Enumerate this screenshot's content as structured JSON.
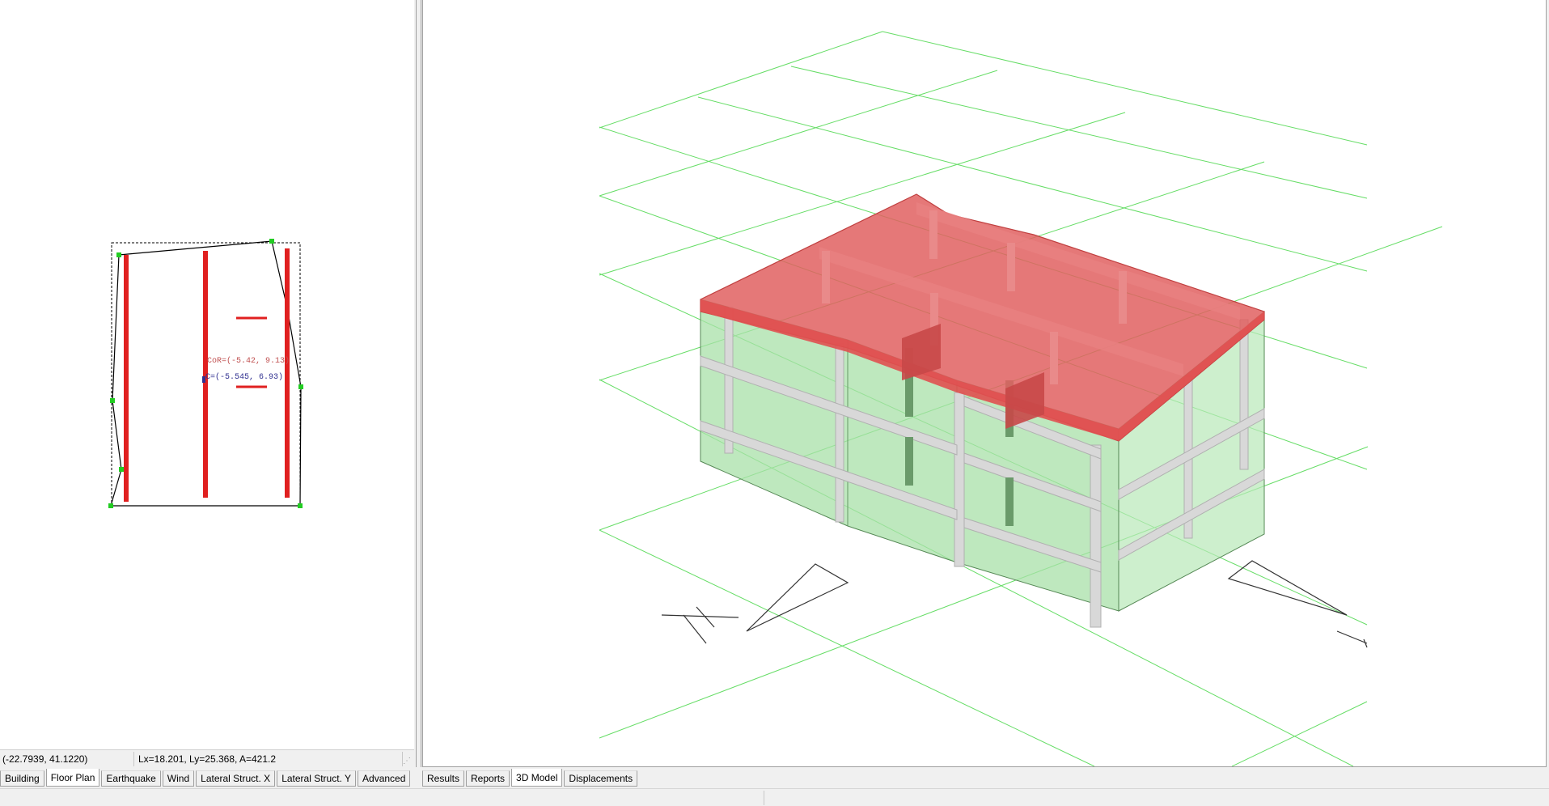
{
  "floor_plan": {
    "labels": {
      "center_of_rigidity": "CoR=(-5.42, 9.13)",
      "center_of_mass": "C=(-5.545, 6.93)"
    },
    "colors": {
      "wall": "#e02020",
      "outline": "#000000",
      "vertex": "#22cc22",
      "cor_text": "#c05050",
      "cm_text": "#303090"
    }
  },
  "left_status": {
    "cursor_coords": "(-22.7939, 41.1220)",
    "dimensions": "Lx=18.201, Ly=25.368, A=421.2"
  },
  "left_tabs": [
    {
      "label": "Building",
      "active": false
    },
    {
      "label": "Floor Plan",
      "active": true
    },
    {
      "label": "Earthquake",
      "active": false
    },
    {
      "label": "Wind",
      "active": false
    },
    {
      "label": "Lateral Struct. X",
      "active": false
    },
    {
      "label": "Lateral Struct. Y",
      "active": false
    },
    {
      "label": "Advanced",
      "active": false
    }
  ],
  "right_tabs": [
    {
      "label": "Results",
      "active": false
    },
    {
      "label": "Reports",
      "active": false
    },
    {
      "label": "3D Model",
      "active": true
    },
    {
      "label": "Displacements",
      "active": false
    }
  ],
  "model_3d": {
    "colors": {
      "grid": "#66dd66",
      "roof": "#e06060",
      "walls": "#a8e0a8",
      "frames": "#d8d8d8",
      "axes": "#333333"
    }
  }
}
